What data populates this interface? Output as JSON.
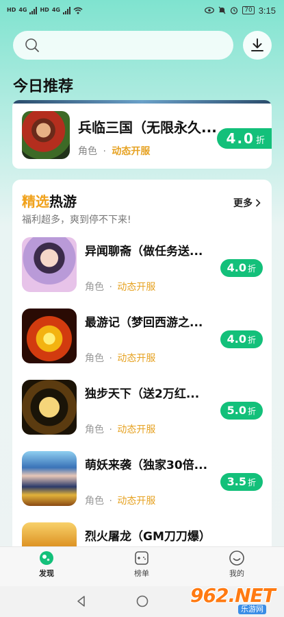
{
  "status_bar": {
    "left_labels": [
      "HD",
      "4G",
      "HD",
      "4G"
    ],
    "battery": "70",
    "time": "3:15"
  },
  "header": {
    "search": {
      "placeholder": ""
    },
    "download_icon": "download-icon"
  },
  "today": {
    "title": "今日推荐",
    "item": {
      "title": "兵临三国（无限永久...",
      "category": "角色",
      "separator": "·",
      "tag": "动态开服",
      "discount_value": "4.0",
      "discount_unit": "折"
    }
  },
  "hot": {
    "title_accent": "精选",
    "title_rest": "热游",
    "subtitle": "福利超多，爽到停不下来!",
    "more_label": "更多",
    "games": [
      {
        "title": "异闻聊斋（做任务送...",
        "category": "角色",
        "separator": "·",
        "tag": "动态开服",
        "discount_value": "4.0",
        "discount_unit": "折"
      },
      {
        "title": "最游记（梦回西游之...",
        "category": "角色",
        "separator": "·",
        "tag": "动态开服",
        "discount_value": "4.0",
        "discount_unit": "折"
      },
      {
        "title": "独步天下（送2万红...",
        "category": "角色",
        "separator": "·",
        "tag": "动态开服",
        "discount_value": "5.0",
        "discount_unit": "折"
      },
      {
        "title": "萌妖来袭（独家30倍...",
        "category": "角色",
        "separator": "·",
        "tag": "动态开服",
        "discount_value": "3.5",
        "discount_unit": "折"
      },
      {
        "title": "烈火屠龙（GM刀刀爆）"
      }
    ]
  },
  "bottom_nav": [
    {
      "label": "发现",
      "icon": "discover-icon",
      "active": true
    },
    {
      "label": "榜单",
      "icon": "gamepad-icon",
      "active": false
    },
    {
      "label": "我的",
      "icon": "smile-icon",
      "active": false
    }
  ],
  "watermark": {
    "brand": "962.NET",
    "sub": "乐游网"
  },
  "colors": {
    "accent_green": "#13c07a",
    "accent_orange": "#e6a222",
    "title_orange": "#f0a11a"
  }
}
